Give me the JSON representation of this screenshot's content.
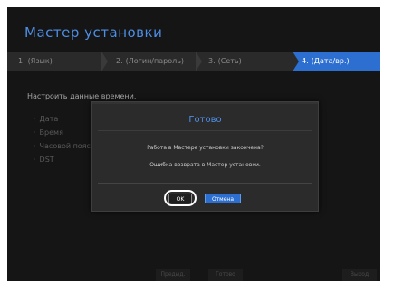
{
  "wizard": {
    "title": "Мастер установки",
    "steps": [
      {
        "num": "1.",
        "label": "(Язык)",
        "active": false
      },
      {
        "num": "2.",
        "label": "(Логин/пароль)",
        "active": false
      },
      {
        "num": "3.",
        "label": "(Сеть)",
        "active": false
      },
      {
        "num": "4.",
        "label": "(Дата/вр.)",
        "active": true
      }
    ]
  },
  "main": {
    "section_label": "Настроить данные времени.",
    "menu": [
      "Дата",
      "Время",
      "Часовой пояс",
      "DST"
    ]
  },
  "dialog": {
    "title": "Готово",
    "message1": "Работа в Мастере установки закончена?",
    "message2": "Ошибка возврата в Мастер установки.",
    "ok_label": "OK",
    "cancel_label": "Отмена"
  },
  "footer": {
    "prev_label": "Предыд.",
    "done_label": "Готово",
    "exit_label": "Выход"
  },
  "colors": {
    "accent": "#2d6fd0",
    "title": "#4d8fe6",
    "background": "#151515"
  }
}
